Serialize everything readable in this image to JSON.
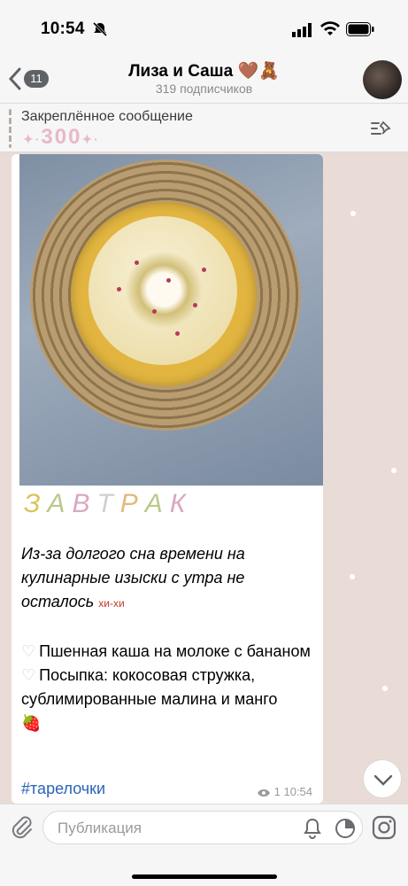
{
  "status": {
    "time": "10:54"
  },
  "header": {
    "back_count": "11",
    "title": "Лиза и Саша",
    "title_emoji": "🤎🧸",
    "subtitle": "319 подписчиков"
  },
  "pinned": {
    "label": "Закреплённое сообщение",
    "value": "300",
    "sparkles": "✦·"
  },
  "post": {
    "heading_letters": [
      "З",
      "А",
      "В",
      "Т",
      "Р",
      "А",
      "К"
    ],
    "heading_colors": [
      "#d9c45a",
      "#b9c98c",
      "#d9a8c0",
      "#cfcfcf",
      "#e2b97a",
      "#b9c98c",
      "#d9a8c0"
    ],
    "intro": "Из-за долгого сна времени на кулинарные изыски с утра не осталось",
    "intro_emoji": "хи-хи",
    "items": [
      {
        "bullet": "♡",
        "text": "Пшенная каша на молоке с бананом"
      },
      {
        "bullet": "♡",
        "text": "Посыпка: кокосовая стружка, сублимированные малина и манго"
      }
    ],
    "item_emoji": "🍓",
    "hashtag": "#тарелочки",
    "views": "1",
    "time": "10:54"
  },
  "input": {
    "placeholder": "Публикация"
  }
}
